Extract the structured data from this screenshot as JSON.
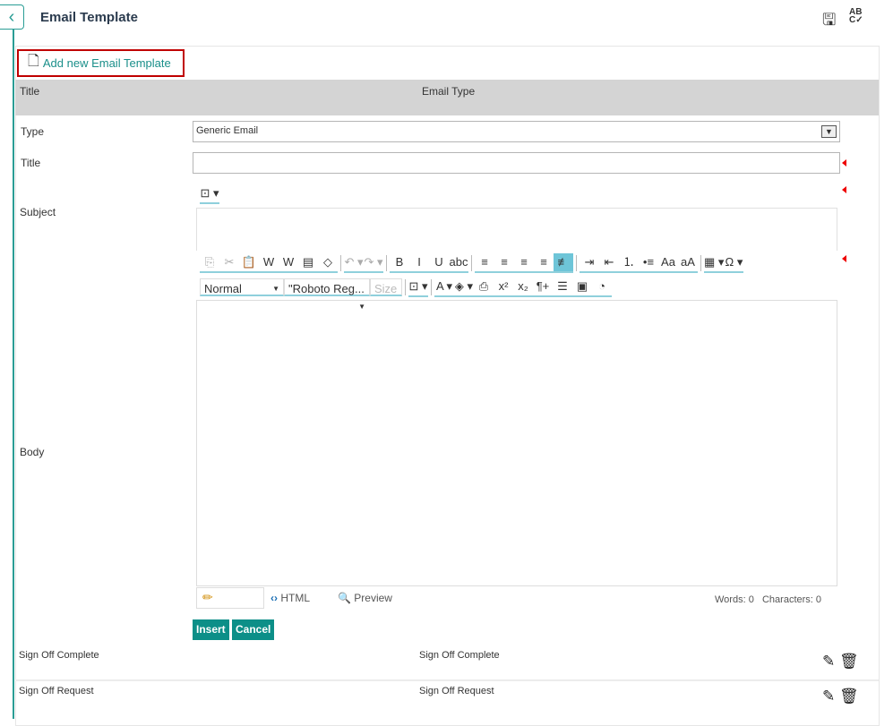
{
  "header": {
    "title": "Email Template",
    "back_icon": "chevron-left-icon",
    "save_icon": "save-icon",
    "spell_icon": "spellcheck-icon",
    "spell_text_top": "AB",
    "spell_text_bottom": "C✓"
  },
  "add_button": {
    "label": "Add new Email Template",
    "icon": "add-document-icon"
  },
  "table_header": {
    "title": "Title",
    "email_type": "Email Type"
  },
  "form": {
    "type_label": "Type",
    "type_value": "Generic Email",
    "title_label": "Title",
    "title_value": "",
    "subject_label": "Subject",
    "body_label": "Body"
  },
  "toolbar_row1": [
    {
      "name": "copy-icon",
      "g": "⎘",
      "dis": true
    },
    {
      "name": "cut-icon",
      "g": "✂",
      "dis": true
    },
    {
      "name": "paste-icon",
      "g": "📋"
    },
    {
      "name": "paste-word-icon",
      "g": "W"
    },
    {
      "name": "paste-word-2-icon",
      "g": "W"
    },
    {
      "name": "paste-text-icon",
      "g": "▤"
    },
    {
      "name": "paste-html-icon",
      "g": "◇"
    },
    {
      "sep": true
    },
    {
      "name": "undo-icon",
      "g": "↶ ▾",
      "dis": true
    },
    {
      "name": "redo-icon",
      "g": "↷ ▾",
      "dis": true
    },
    {
      "sep": true
    },
    {
      "name": "bold-icon",
      "g": "B"
    },
    {
      "name": "italic-icon",
      "g": "I"
    },
    {
      "name": "underline-icon",
      "g": "U"
    },
    {
      "name": "strikethrough-icon",
      "g": "abc"
    },
    {
      "sep": true
    },
    {
      "name": "align-left-icon",
      "g": "≡"
    },
    {
      "name": "align-center-icon",
      "g": "≡"
    },
    {
      "name": "align-right-icon",
      "g": "≡"
    },
    {
      "name": "justify-icon",
      "g": "≡"
    },
    {
      "name": "remove-alignment-icon",
      "g": "≢",
      "act": true
    },
    {
      "sep": true
    },
    {
      "name": "indent-icon",
      "g": "⇥"
    },
    {
      "name": "outdent-icon",
      "g": "⇤"
    },
    {
      "name": "numbered-list-icon",
      "g": "⒈"
    },
    {
      "name": "bullet-list-icon",
      "g": "•≡"
    },
    {
      "name": "convert-case-icon",
      "g": "Aa"
    },
    {
      "name": "uppercase-icon",
      "g": "aA"
    },
    {
      "sep": true
    },
    {
      "name": "table-icon",
      "g": "▦ ▾"
    },
    {
      "name": "special-character-icon",
      "g": "Ω ▾"
    }
  ],
  "toolbar_row2": {
    "paragraph": "Normal",
    "font": "\"Roboto Reg...",
    "size": "Size",
    "tools": [
      {
        "name": "insert-snippet-icon",
        "g": "⊡ ▾"
      },
      {
        "sep": true
      },
      {
        "name": "font-color-icon",
        "g": "A ▾"
      },
      {
        "name": "highlight-color-icon",
        "g": "◈ ▾"
      },
      {
        "name": "print-icon",
        "g": "⎙"
      },
      {
        "name": "superscript-icon",
        "g": "x²"
      },
      {
        "name": "subscript-icon",
        "g": "x₂"
      },
      {
        "name": "paragraph-icon",
        "g": "¶+"
      },
      {
        "name": "horizontal-rule-icon",
        "g": "☰"
      },
      {
        "name": "form-icon",
        "g": "▣"
      },
      {
        "name": "clock-icon",
        "g": "◔"
      }
    ]
  },
  "editor_footer": {
    "html_label": "HTML",
    "preview_label": "Preview",
    "words": "Words: 0",
    "characters": "Characters: 0"
  },
  "buttons": {
    "insert": "Insert",
    "cancel": "Cancel"
  },
  "rows": [
    {
      "title": "Sign Off Complete",
      "email_type": "Sign Off Complete"
    },
    {
      "title": "Sign Off Request",
      "email_type": "Sign Off Request"
    }
  ]
}
